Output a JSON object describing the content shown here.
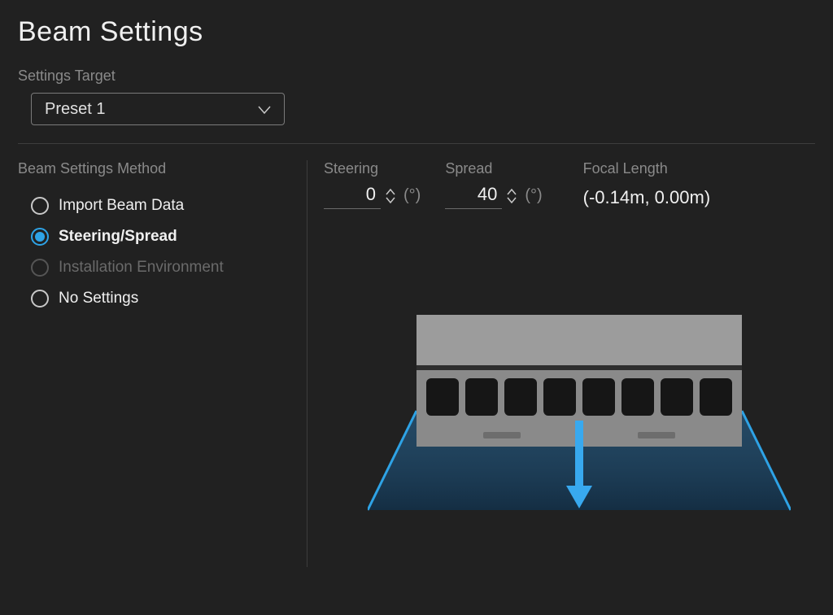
{
  "title": "Beam Settings",
  "settings_target": {
    "label": "Settings Target",
    "value": "Preset 1"
  },
  "method": {
    "label": "Beam Settings Method",
    "options": [
      {
        "label": "Import Beam Data",
        "selected": false,
        "disabled": false
      },
      {
        "label": "Steering/Spread",
        "selected": true,
        "disabled": false
      },
      {
        "label": "Installation Environment",
        "selected": false,
        "disabled": true
      },
      {
        "label": "No Settings",
        "selected": false,
        "disabled": false
      }
    ]
  },
  "params": {
    "steering": {
      "label": "Steering",
      "value": "0",
      "unit": "(°)"
    },
    "spread": {
      "label": "Spread",
      "value": "40",
      "unit": "(°)"
    },
    "focal": {
      "label": "Focal Length",
      "value": "(-0.14m, 0.00m)"
    }
  },
  "colors": {
    "accent": "#2ea3e6",
    "bg": "#212121",
    "muted": "#8a8a8a"
  }
}
